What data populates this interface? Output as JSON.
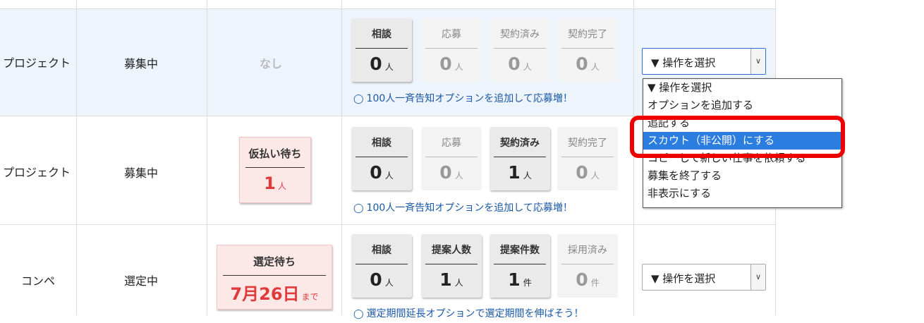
{
  "rows": [
    {
      "type": "プロジェクト",
      "status": "募集中",
      "pending": {
        "empty": "なし"
      },
      "counters": [
        {
          "label": "相談",
          "value": "0",
          "unit": "人",
          "active": true
        },
        {
          "label": "応募",
          "value": "0",
          "unit": "人",
          "active": false
        },
        {
          "label": "契約済み",
          "value": "0",
          "unit": "人",
          "active": false
        },
        {
          "label": "契約完了",
          "value": "0",
          "unit": "人",
          "active": false
        }
      ],
      "promo": "100人一斉告知オプションを追加して応募増！",
      "action": "▼ 操作を選択"
    },
    {
      "type": "プロジェクト",
      "status": "募集中",
      "pending": {
        "label": "仮払い待ち",
        "value": "1",
        "unit": "人"
      },
      "counters": [
        {
          "label": "相談",
          "value": "0",
          "unit": "人",
          "active": true
        },
        {
          "label": "応募",
          "value": "0",
          "unit": "人",
          "active": false
        },
        {
          "label": "契約済み",
          "value": "1",
          "unit": "人",
          "active": true
        },
        {
          "label": "契約完了",
          "value": "0",
          "unit": "人",
          "active": false
        }
      ],
      "promo": "100人一斉告知オプションを追加して応募増！"
    },
    {
      "type": "コンペ",
      "status": "選定中",
      "pending": {
        "label": "選定待ち",
        "value": "7月26日",
        "unit": "まで"
      },
      "counters": [
        {
          "label": "相談",
          "value": "0",
          "unit": "人",
          "active": true
        },
        {
          "label": "提案人数",
          "value": "1",
          "unit": "人",
          "active": true
        },
        {
          "label": "提案件数",
          "value": "1",
          "unit": "件",
          "active": true
        },
        {
          "label": "採用済み",
          "value": "0",
          "unit": "件",
          "active": false
        }
      ],
      "promo": "選定期間延長オプションで選定期間を伸ばそう！",
      "action": "▼ 操作を選択"
    }
  ],
  "dropdown": {
    "options": [
      "▼ 操作を選択",
      "オプションを追加する",
      "追記する",
      "スカウト（非公開）にする",
      "コピーして新しい仕事を依頼する",
      "募集を終了する",
      "非表示にする"
    ],
    "highlighted_index": 3
  },
  "colors": {
    "highlight": "#2c7de0",
    "annotation": "#ee0000",
    "pending_red": "#e03a3a",
    "link_blue": "#1a58a8"
  }
}
